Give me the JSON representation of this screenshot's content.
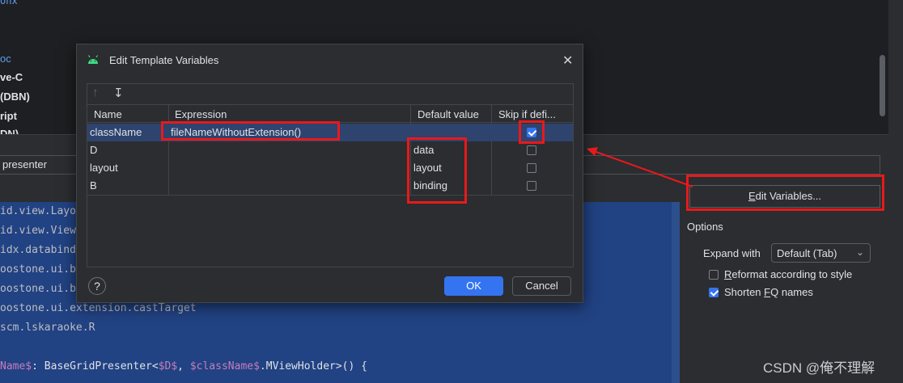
{
  "tree": {
    "items": [
      "onx",
      "oc",
      "ve-C",
      "(DBN)",
      "ript",
      "DN)"
    ]
  },
  "abbreviation": {
    "value": "presenter"
  },
  "code": {
    "lines": [
      "id.view.Layo",
      "id.view.View",
      "idx.databind",
      "oostone.ui.b",
      "oostone.ui.b",
      "oostone.ui.extension.castTarget",
      "scm.lskaraoke.R",
      ""
    ],
    "last_line": {
      "a": "Name$",
      "b": ": BaseGridPresenter<",
      "c": "$D$",
      "d": ", ",
      "e": "$className$",
      "f": ".MViewHolder>() {"
    }
  },
  "right_panel": {
    "edit_variables": {
      "u": "E",
      "rest": "dit Variables..."
    },
    "options_label": "Options",
    "expand_with": {
      "label": "Expand with",
      "value": "Default (Tab)"
    },
    "reformat": {
      "u": "R",
      "rest": "eformat according to style",
      "checked": false
    },
    "shorten": {
      "before": "Shorten ",
      "u": "F",
      "rest": "Q names",
      "checked": true
    }
  },
  "dialog": {
    "title": "Edit Template Variables",
    "columns": [
      "Name",
      "Expression",
      "Default value",
      "Skip if defi..."
    ],
    "rows": [
      {
        "name": "className",
        "expression": "fileNameWithoutExtension()",
        "default": "",
        "skip": true
      },
      {
        "name": "D",
        "expression": "",
        "default": "data",
        "skip": false
      },
      {
        "name": "layout",
        "expression": "",
        "default": "layout",
        "skip": false
      },
      {
        "name": "B",
        "expression": "",
        "default": "binding",
        "skip": false
      }
    ],
    "ok_label": "OK",
    "cancel_label": "Cancel",
    "help_label": "?"
  },
  "watermark": "CSDN @俺不理解",
  "colors": {
    "accent": "#3574f0",
    "annotation": "#e8191b",
    "editor_bg": "#214283"
  }
}
